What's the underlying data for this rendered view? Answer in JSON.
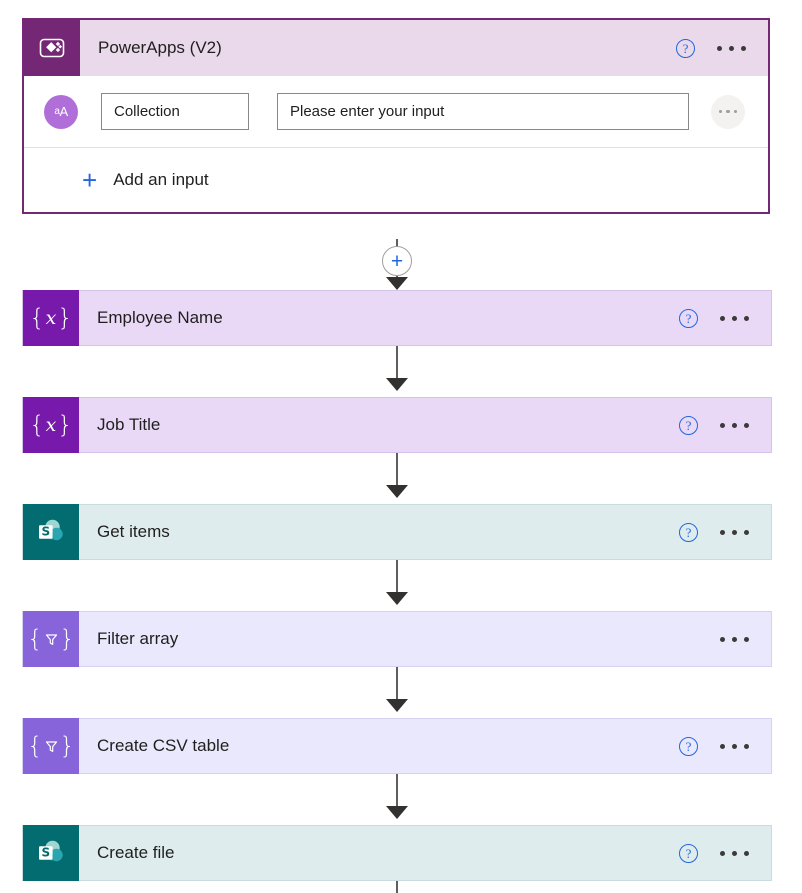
{
  "trigger": {
    "title": "PowerApps (V2)",
    "icon": "powerapps-icon",
    "help_label": "?",
    "inputs": [
      {
        "avatar_prefix": "a",
        "avatar_suffix": "A",
        "name_value": "Collection",
        "placeholder_value": "Please enter your input"
      }
    ],
    "add_input_label": "Add an input",
    "add_input_plus": "+",
    "border_color": "#742774",
    "header_color": "#e9d9ea"
  },
  "connectors": {
    "add_button_label": "+"
  },
  "actions": [
    {
      "title": "Employee Name",
      "icon": "variable-icon",
      "kind": "variable",
      "has_help": true,
      "help_label": "?"
    },
    {
      "title": "Job Title",
      "icon": "variable-icon",
      "kind": "variable",
      "has_help": true,
      "help_label": "?"
    },
    {
      "title": "Get items",
      "icon": "sharepoint-icon",
      "kind": "sharepoint",
      "has_help": true,
      "help_label": "?"
    },
    {
      "title": "Filter array",
      "icon": "data-operation-icon",
      "kind": "dataop",
      "has_help": false,
      "help_label": "?"
    },
    {
      "title": "Create CSV table",
      "icon": "data-operation-icon",
      "kind": "dataop",
      "has_help": true,
      "help_label": "?"
    },
    {
      "title": "Create file",
      "icon": "sharepoint-icon",
      "kind": "sharepoint",
      "has_help": true,
      "help_label": "?"
    }
  ],
  "colors": {
    "variable_icon": "#7719aa",
    "variable_body": "#e9d9f7",
    "dataop_icon": "#8764da",
    "dataop_body": "#eae8fc",
    "sharepoint_icon": "#036c70",
    "sharepoint_body": "#dfeced",
    "powerapps_icon": "#742774",
    "accent_blue": "#2266dd"
  }
}
